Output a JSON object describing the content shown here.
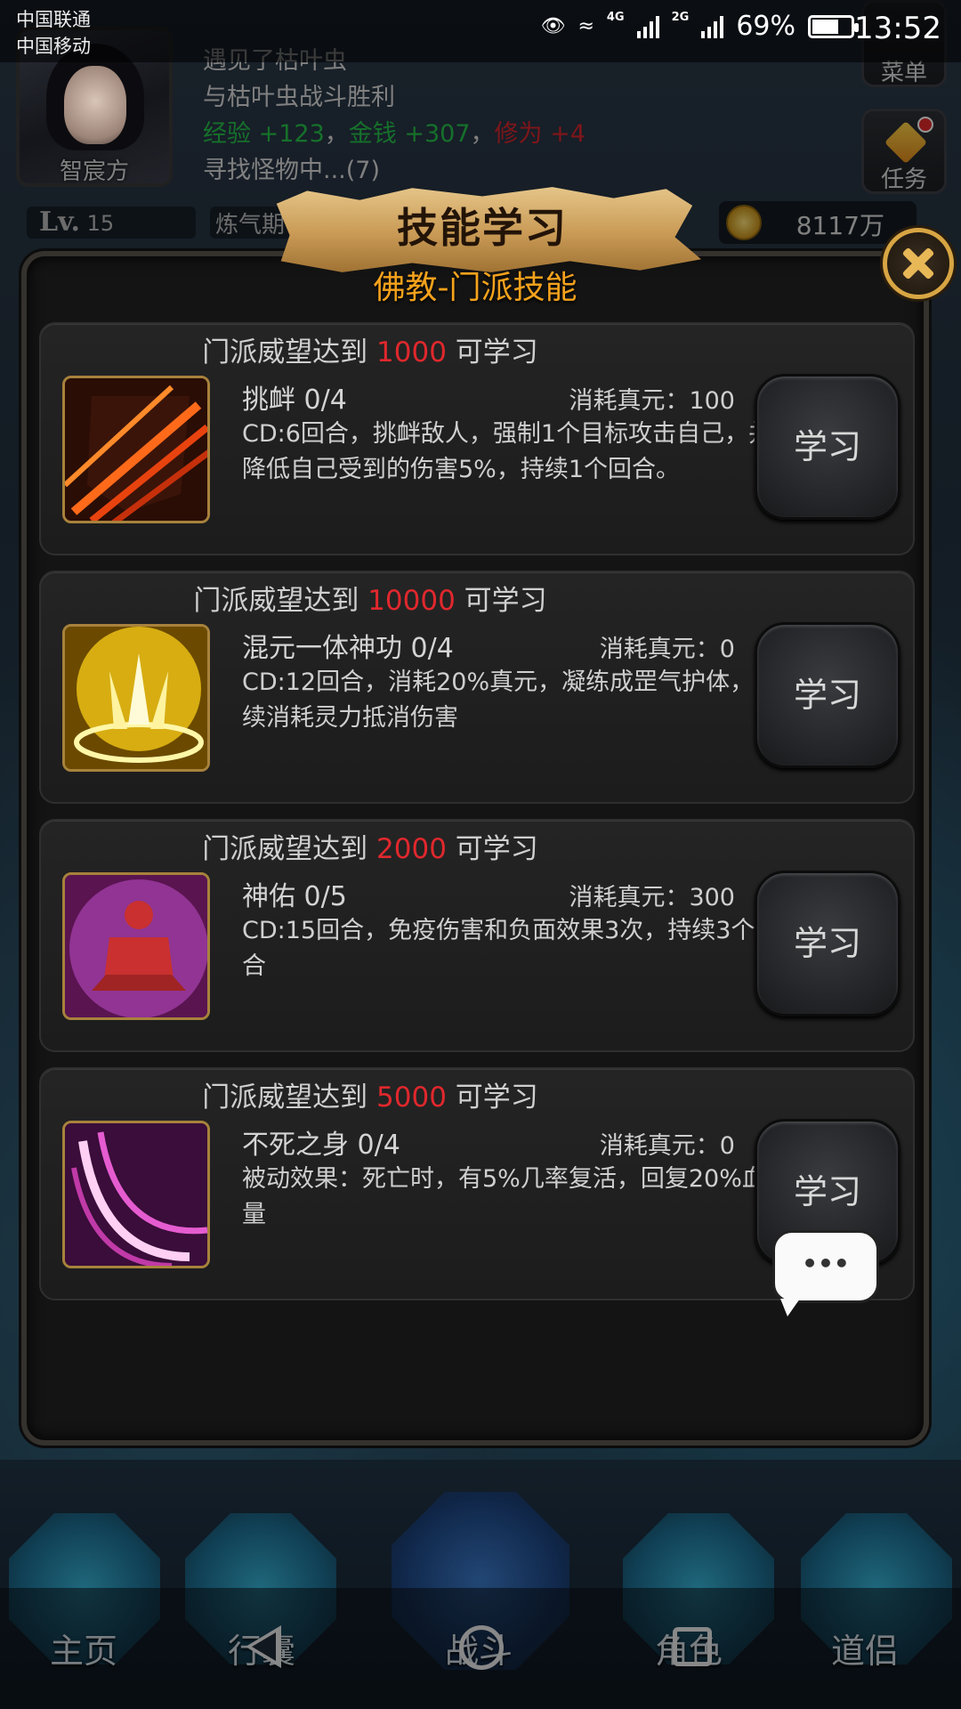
{
  "status_bar": {
    "carrier_1": "中国联通",
    "carrier_2": "中国移动",
    "net_4g": "4G",
    "net_2g": "2G",
    "battery": "69%",
    "battery_level": 0.69,
    "time": "13:52"
  },
  "player": {
    "name": "智宸方",
    "level_label": "Lv.",
    "level": "15",
    "realm": "炼气期",
    "money": "8117万"
  },
  "log": {
    "line1": "遇见了枯叶虫",
    "line2": "与枯叶虫战斗胜利",
    "exp_label": "经验",
    "exp_value": "+123",
    "sep1": "，",
    "gold_label": "金钱",
    "gold_value": "+307",
    "sep2": "，",
    "cultivation_label": "修为",
    "cultivation_value": "+4",
    "line4": "寻找怪物中...(7)"
  },
  "side_buttons": {
    "menu": "菜单",
    "task": "任务"
  },
  "dialog": {
    "title": "技能学习",
    "subtitle": "佛教-门派技能",
    "skills": [
      {
        "req_prefix": "门派威望达到 ",
        "req_value": "1000",
        "req_suffix": " 可学习",
        "name": "挑衅 0/4",
        "cost": "消耗真元：100",
        "desc": "CD:6回合，挑衅敌人，强制1个目标攻击自己，并降低自己受到的伤害5%，持续1个回合。",
        "button": "学习",
        "icon": "taunt-slash-icon"
      },
      {
        "req_prefix": "门派威望达到 ",
        "req_value": "10000",
        "req_suffix": " 可学习",
        "name": "混元一体神功 0/4",
        "cost": "消耗真元：0",
        "desc": "CD:12回合，消耗20%真元，凝练成罡气护体，持续消耗灵力抵消伤害",
        "button": "学习",
        "icon": "golden-aura-icon"
      },
      {
        "req_prefix": "门派威望达到 ",
        "req_value": "2000",
        "req_suffix": " 可学习",
        "name": "神佑 0/5",
        "cost": "消耗真元：300",
        "desc": "CD:15回合，免疫伤害和负面效果3次，持续3个回合",
        "button": "学习",
        "icon": "meditating-monk-icon"
      },
      {
        "req_prefix": "门派威望达到 ",
        "req_value": "5000",
        "req_suffix": " 可学习",
        "name": "不死之身 0/4",
        "cost": "消耗真元：0",
        "desc": "被动效果：死亡时，有5%几率复活，回复20%血量",
        "button": "学习",
        "icon": "pink-slash-icon"
      }
    ]
  },
  "chat_bubble": "•••",
  "bottom_nav": {
    "home": "主页",
    "bag": "行囊",
    "battle": "战斗",
    "role": "角色",
    "partner": "道侣"
  },
  "colors": {
    "accent_orange": "#f5a21c",
    "red_value": "#e0282d",
    "green_value": "#26c24a"
  }
}
